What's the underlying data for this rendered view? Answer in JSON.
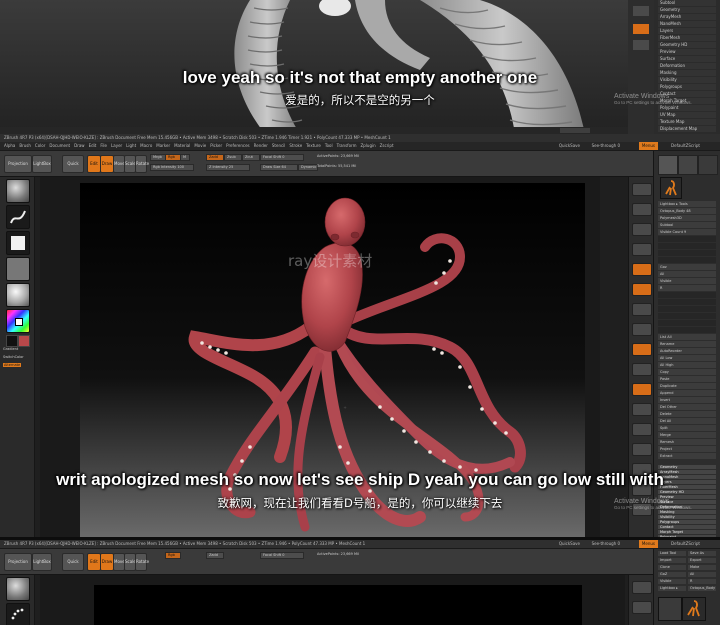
{
  "frame1": {
    "subtitle_en": "love yeah so it's not that empty another one",
    "subtitle_zh": "爱是的，所以不是空的另一个",
    "activate_title": "Activate Windows",
    "activate_sub": "Go to PC settings to activate Windows.",
    "right_menu": [
      "Subtool",
      "Geometry",
      "ArrayMesh",
      "NanoMesh",
      "Layers",
      "FiberMesh",
      "Geometry HD",
      "Preview",
      "Surface",
      "Deformation",
      "Masking",
      "Visibility",
      "Polygroups",
      "Contact",
      "Morph Target",
      "Polypaint",
      "UV Map",
      "Texture Map",
      "Displacement Map"
    ]
  },
  "frame2": {
    "title_strip": "ZBrush 4R7 P3 (x64)[DSAH-QJHD-WEIO-KLZE] : ZBrush Document   Free Mem 15.456GB • Active Mem 3498 • Scratch Disk 503 • ZTime 1.946 Timer 1.921 • PolyCount 47.333 MP • MeshCount 1",
    "menu": [
      "Alpha",
      "Brush",
      "Color",
      "Document",
      "Draw",
      "Edit",
      "File",
      "Layer",
      "Light",
      "Macro",
      "Marker",
      "Material",
      "Movie",
      "Picker",
      "Preferences",
      "Render",
      "Stencil",
      "Stroke",
      "Texture",
      "Tool",
      "Transform",
      "Zplugin",
      "Zscript"
    ],
    "quicksave": "QuickSave",
    "see_through": "See-through 0",
    "menus_label": "Menus",
    "default_zscript": "DefaultZScript",
    "toolbar": {
      "projection_master": "Projection Master",
      "lightbox": "LightBox",
      "quick_sketch": "Quick Sketch",
      "edit": "Edit",
      "draw": "Draw",
      "move": "Move",
      "scale": "Scale",
      "rotate": "Rotate",
      "mrgb": "Mrgb",
      "rgb": "Rgb",
      "m": "M",
      "zadd": "Zadd",
      "zsub": "Zsub",
      "zcut": "Zcut",
      "rgb_intensity": "Rgb Intensity 100",
      "z_intensity": "Z Intensity 25",
      "focal_shift": "Focal Shift 0",
      "draw_size": "Draw Size 64",
      "dynamic": "Dynamic",
      "active_points": "ActivePoints: 23,669 Mil",
      "total_points": "TotalPoints: 55,541 Mil"
    },
    "left_shelf": {
      "gradient": "Gradient",
      "switch_color": "SwitchColor",
      "alternate": "Alternate"
    },
    "right_panel": {
      "rows": [
        "Lightbox ▸ Tools",
        "Octopus_Body 48",
        "Polymesh3D",
        "Subtool",
        "Visible Count 9",
        "",
        "",
        "",
        "",
        "Goz",
        "All",
        "Visible",
        "R",
        "",
        "",
        "",
        "",
        "",
        "",
        "List All",
        "Rename",
        "AutoReorder",
        "All Low",
        "All High",
        "Copy",
        "Paste",
        "Duplicate",
        "Append",
        "Insert",
        "Del Other",
        "Delete",
        "Del All",
        "Split",
        "Merge",
        "Remesh",
        "Project",
        "Extract"
      ],
      "lower_menu": [
        "Geometry",
        "ArrayMesh",
        "NanoMesh",
        "Layers",
        "FiberMesh",
        "Geometry HD",
        "Preview",
        "Surface",
        "Deformation",
        "Masking",
        "Visibility",
        "Polygroups",
        "Contact",
        "Morph Target",
        "Polypaint"
      ]
    },
    "watermark": "ray设计素材",
    "subtitle_en": "writ apologized mesh so now let's see ship D yeah you can go low still with",
    "subtitle_zh": "致歉网，现在让我们看看D号船，是的，你可以继续下去",
    "activate_title": "Activate Windows",
    "activate_sub": "Go to PC settings to activate Windows."
  },
  "frame3": {
    "title_strip": "ZBrush 4R7 P3 (x64)[DSAH-QJHD-WEIO-KLZE] : ZBrush Document   Free Mem 15.456GB • Active Mem 3498 • Scratch Disk 503 • ZTime 1.946 • PolyCount 47.333 MP • MeshCount 1",
    "quicksave": "QuickSave",
    "see_through": "See-through 0",
    "menus_label": "Menus",
    "default_zscript": "DefaultZScript",
    "right_rows": [
      "Load Tool",
      "Save As",
      "Import",
      "Export",
      "Clone",
      "Make PolyMesh3D",
      "GoZ",
      "All",
      "Visible",
      "R",
      "Lightbox ▸ Tools",
      "Octopus_Body 48"
    ]
  },
  "colors": {
    "accent": "#e07a1c",
    "clay": "#b8484a",
    "panel": "#2d2d2d"
  }
}
